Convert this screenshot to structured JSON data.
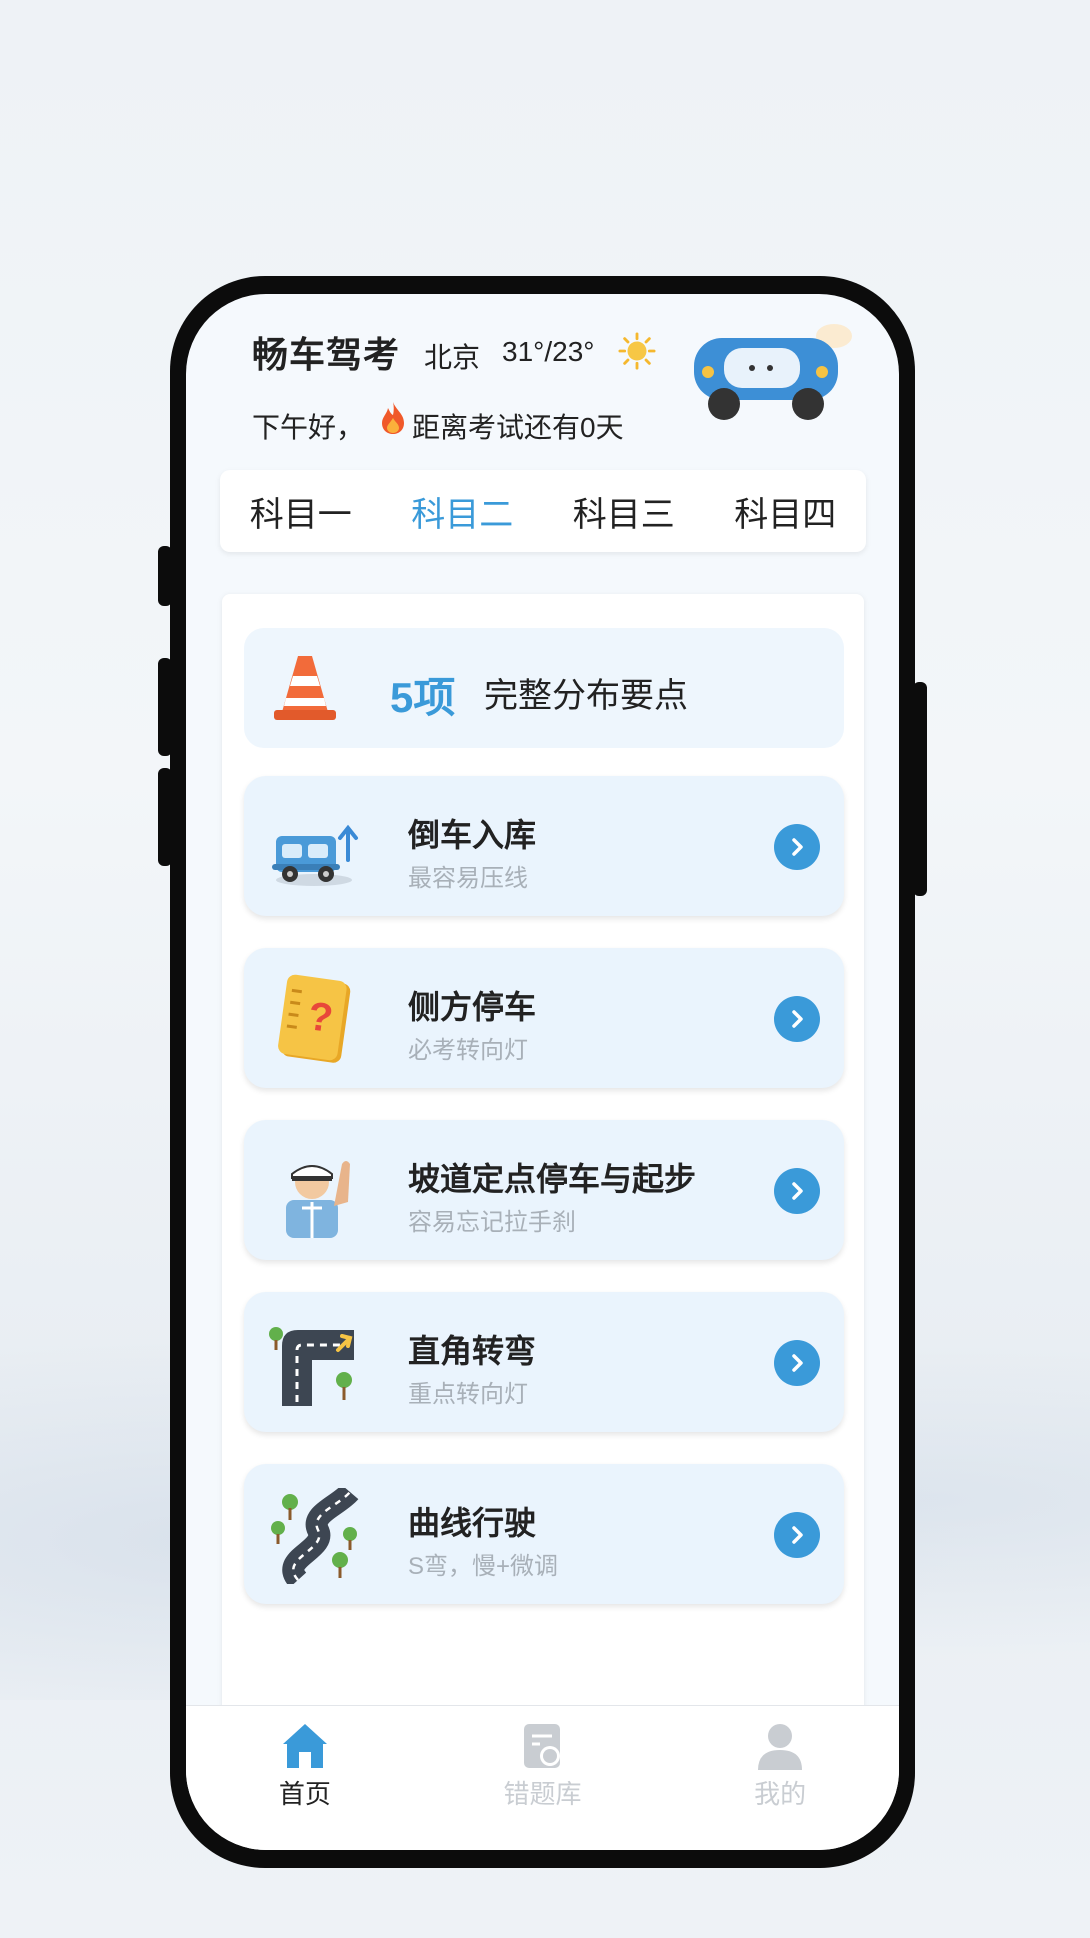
{
  "header": {
    "app_title": "畅车驾考",
    "city": "北京",
    "temperature": "31°/23°",
    "greeting": "下午好，",
    "countdown": "距离考试还有0天"
  },
  "tabs": [
    {
      "label": "科目一",
      "active": false
    },
    {
      "label": "科目二",
      "active": true
    },
    {
      "label": "科目三",
      "active": false
    },
    {
      "label": "科目四",
      "active": false
    }
  ],
  "summary": {
    "count": "5项",
    "description": "完整分布要点"
  },
  "items": [
    {
      "title": "倒车入库",
      "subtitle": "最容易压线",
      "icon": "truck-reverse-icon"
    },
    {
      "title": "侧方停车",
      "subtitle": "必考转向灯",
      "icon": "question-note-icon"
    },
    {
      "title": "坡道定点停车与起步",
      "subtitle": "容易忘记拉手刹",
      "icon": "traffic-officer-icon"
    },
    {
      "title": "直角转弯",
      "subtitle": "重点转向灯",
      "icon": "right-angle-road-icon"
    },
    {
      "title": "曲线行驶",
      "subtitle": "S弯，慢+微调",
      "icon": "curve-road-icon"
    }
  ],
  "bottom_nav": [
    {
      "label": "首页",
      "icon": "home-icon",
      "active": true
    },
    {
      "label": "错题库",
      "icon": "wrong-questions-icon",
      "active": false
    },
    {
      "label": "我的",
      "icon": "profile-icon",
      "active": false
    }
  ],
  "colors": {
    "accent": "#3a9ad9",
    "subtitle_gray": "#a8b0b8",
    "item_bg": "#eaf4fd"
  }
}
